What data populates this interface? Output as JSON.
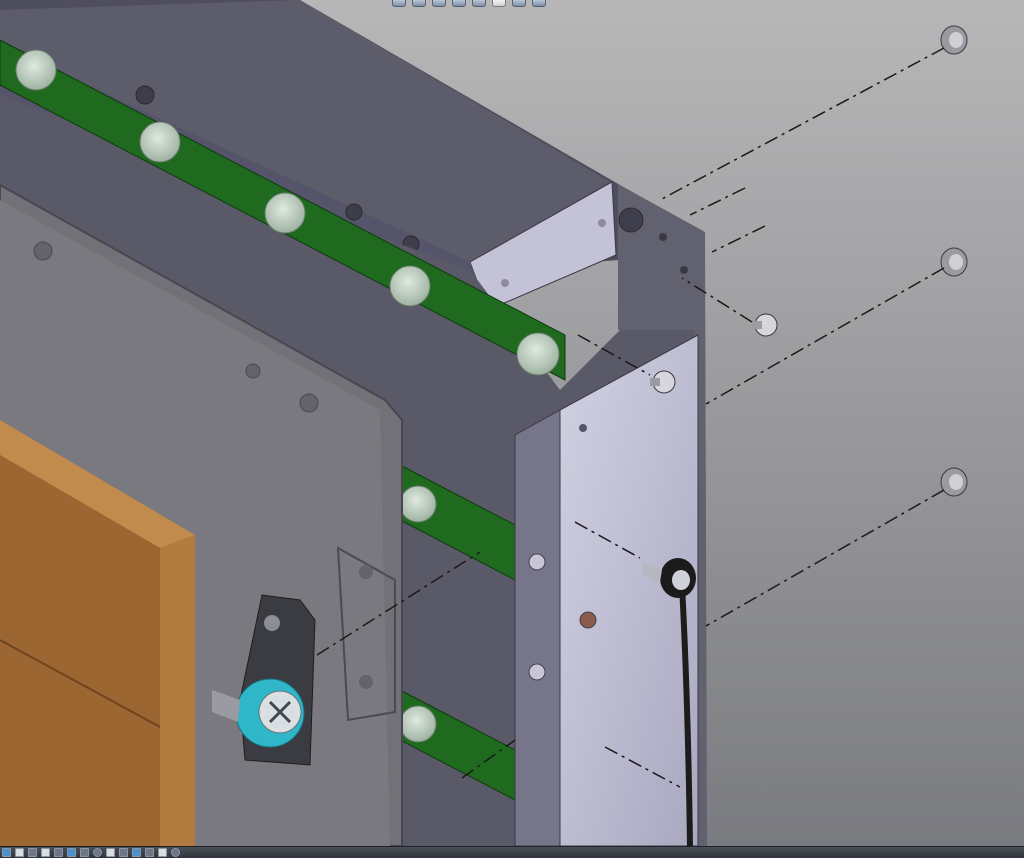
{
  "scene": {
    "background_top": "#b5b5b5",
    "background_bottom": "#7b7c80",
    "sheet_metal": "#5c5b6a",
    "bracket_face": "#c6c4d8",
    "green_strip": "#1f6a1f",
    "wood": "#a06a34",
    "clip_accent": "#2fb6c8"
  },
  "hud_toolbar": {
    "icons": [
      "view-orientation-icon",
      "zoom-fit-icon",
      "section-view-icon",
      "display-style-icon",
      "hide-show-icon",
      "edit-appearance-icon",
      "scene-icon",
      "view-settings-icon"
    ]
  },
  "taskbar": {
    "icons": [
      "windows-icon",
      "explorer-icon",
      "solidworks-icon",
      "app-icon",
      "folder-icon",
      "chart-icon",
      "network-icon",
      "settings-icon",
      "save-icon",
      "edit-icon",
      "photo-icon",
      "tools-icon",
      "monitor-icon",
      "gear-icon"
    ]
  }
}
